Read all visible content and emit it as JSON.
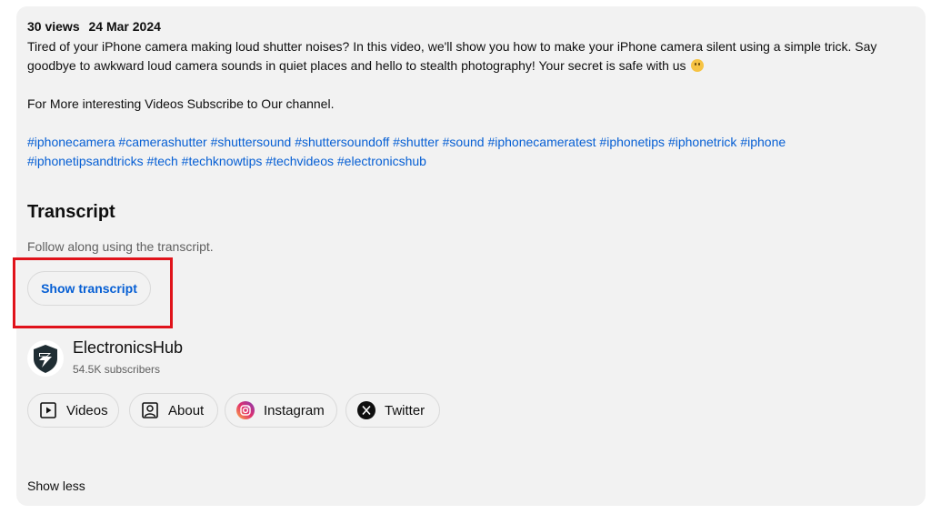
{
  "meta": {
    "views": "30 views",
    "date": "24 Mar 2024"
  },
  "description": {
    "text": "Tired of your iPhone camera making loud shutter noises? In this video, we'll show you how to make your iPhone camera silent using a simple trick. Say goodbye to awkward loud camera sounds in quiet places and hello to stealth photography! Your secret is safe with us",
    "emoji_icon": "winking-face-icon",
    "promo": "For More interesting Videos Subscribe to Our channel."
  },
  "hashtags": [
    "#iphonecamera",
    "#camerashutter",
    "#shuttersound",
    "#shuttersoundoff",
    "#shutter",
    "#sound",
    "#iphonecameratest",
    "#iphonetips",
    "#iphonetrick",
    "#iphone",
    "#iphonetipsandtricks",
    "#tech",
    "#techknowtips",
    "#techvideos",
    "#electronicshub"
  ],
  "transcript": {
    "title": "Transcript",
    "subtitle": "Follow along using the transcript.",
    "button_label": "Show transcript"
  },
  "channel": {
    "name": "ElectronicsHub",
    "subscribers": "54.5K subscribers",
    "links": [
      {
        "label": "Videos",
        "icon": "play-icon"
      },
      {
        "label": "About",
        "icon": "person-icon"
      },
      {
        "label": "Instagram",
        "icon": "instagram-icon"
      },
      {
        "label": "Twitter",
        "icon": "x-icon"
      }
    ]
  },
  "footer": {
    "show_less": "Show less"
  },
  "colors": {
    "card_background": "#f2f2f2",
    "link_blue": "#065fd4",
    "highlight_red": "#e0131b",
    "secondary_text": "#606060"
  }
}
